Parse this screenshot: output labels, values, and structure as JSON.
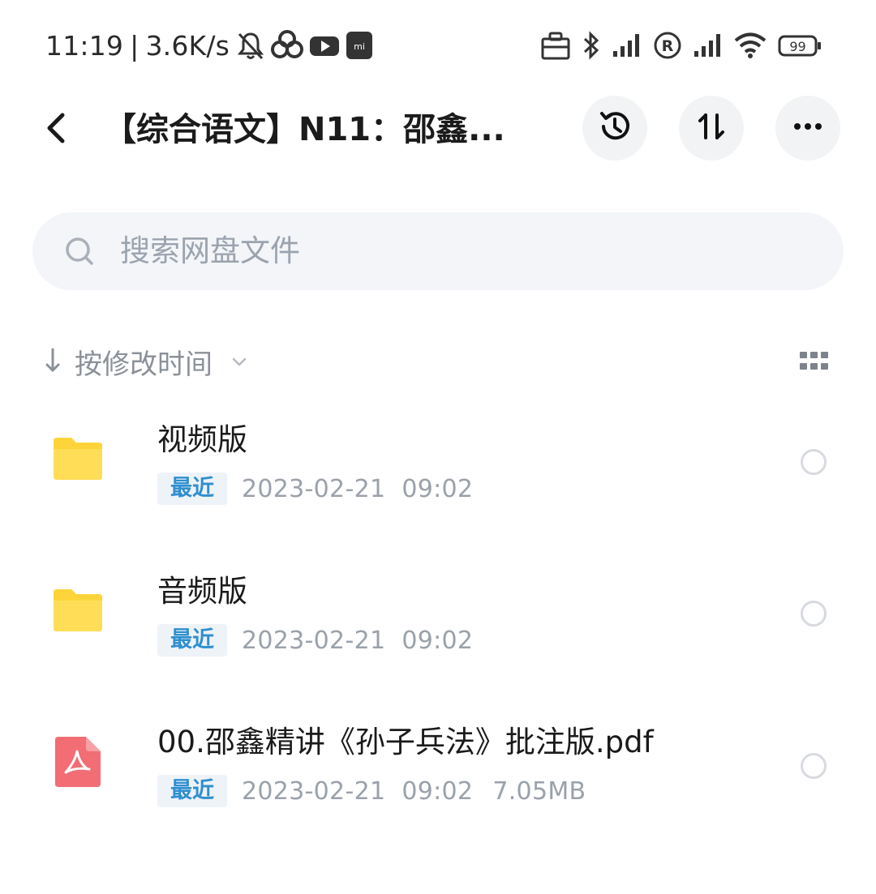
{
  "status_bar": {
    "time": "11:19",
    "separator": "|",
    "speed": "3.6K/s",
    "battery": "99",
    "icons_left": [
      "mute-bell-icon",
      "cloud-app-icon",
      "youtube-icon",
      "mi-icon"
    ],
    "icons_right": [
      "briefcase-icon",
      "bluetooth-icon",
      "signal-icon",
      "roaming-icon",
      "signal-icon",
      "wifi-icon",
      "battery-icon"
    ]
  },
  "header": {
    "title": "【综合语文】N11：邵鑫...",
    "back_icon": "chevron-left-icon",
    "history_icon": "history-icon",
    "transfer_icon": "transfer-icon",
    "more_icon": "more-icon"
  },
  "search": {
    "placeholder": "搜索网盘文件"
  },
  "sort": {
    "label": "按修改时间",
    "direction": "descending"
  },
  "files": [
    {
      "name": "视频版",
      "type": "folder",
      "badge": "最近",
      "date": "2023-02-21",
      "time": "09:02",
      "size": ""
    },
    {
      "name": "音频版",
      "type": "folder",
      "badge": "最近",
      "date": "2023-02-21",
      "time": "09:02",
      "size": ""
    },
    {
      "name": "00.邵鑫精讲《孙子兵法》批注版.pdf",
      "type": "pdf",
      "badge": "最近",
      "date": "2023-02-21",
      "time": "09:02",
      "size": "7.05MB"
    }
  ],
  "colors": {
    "folder": "#ffd43b",
    "pdf": "#f26d74",
    "badge_text": "#2f8fcf",
    "badge_bg": "#eef3f8",
    "search_bg": "#f3f5f8",
    "meta_text": "#9aa1aa"
  }
}
